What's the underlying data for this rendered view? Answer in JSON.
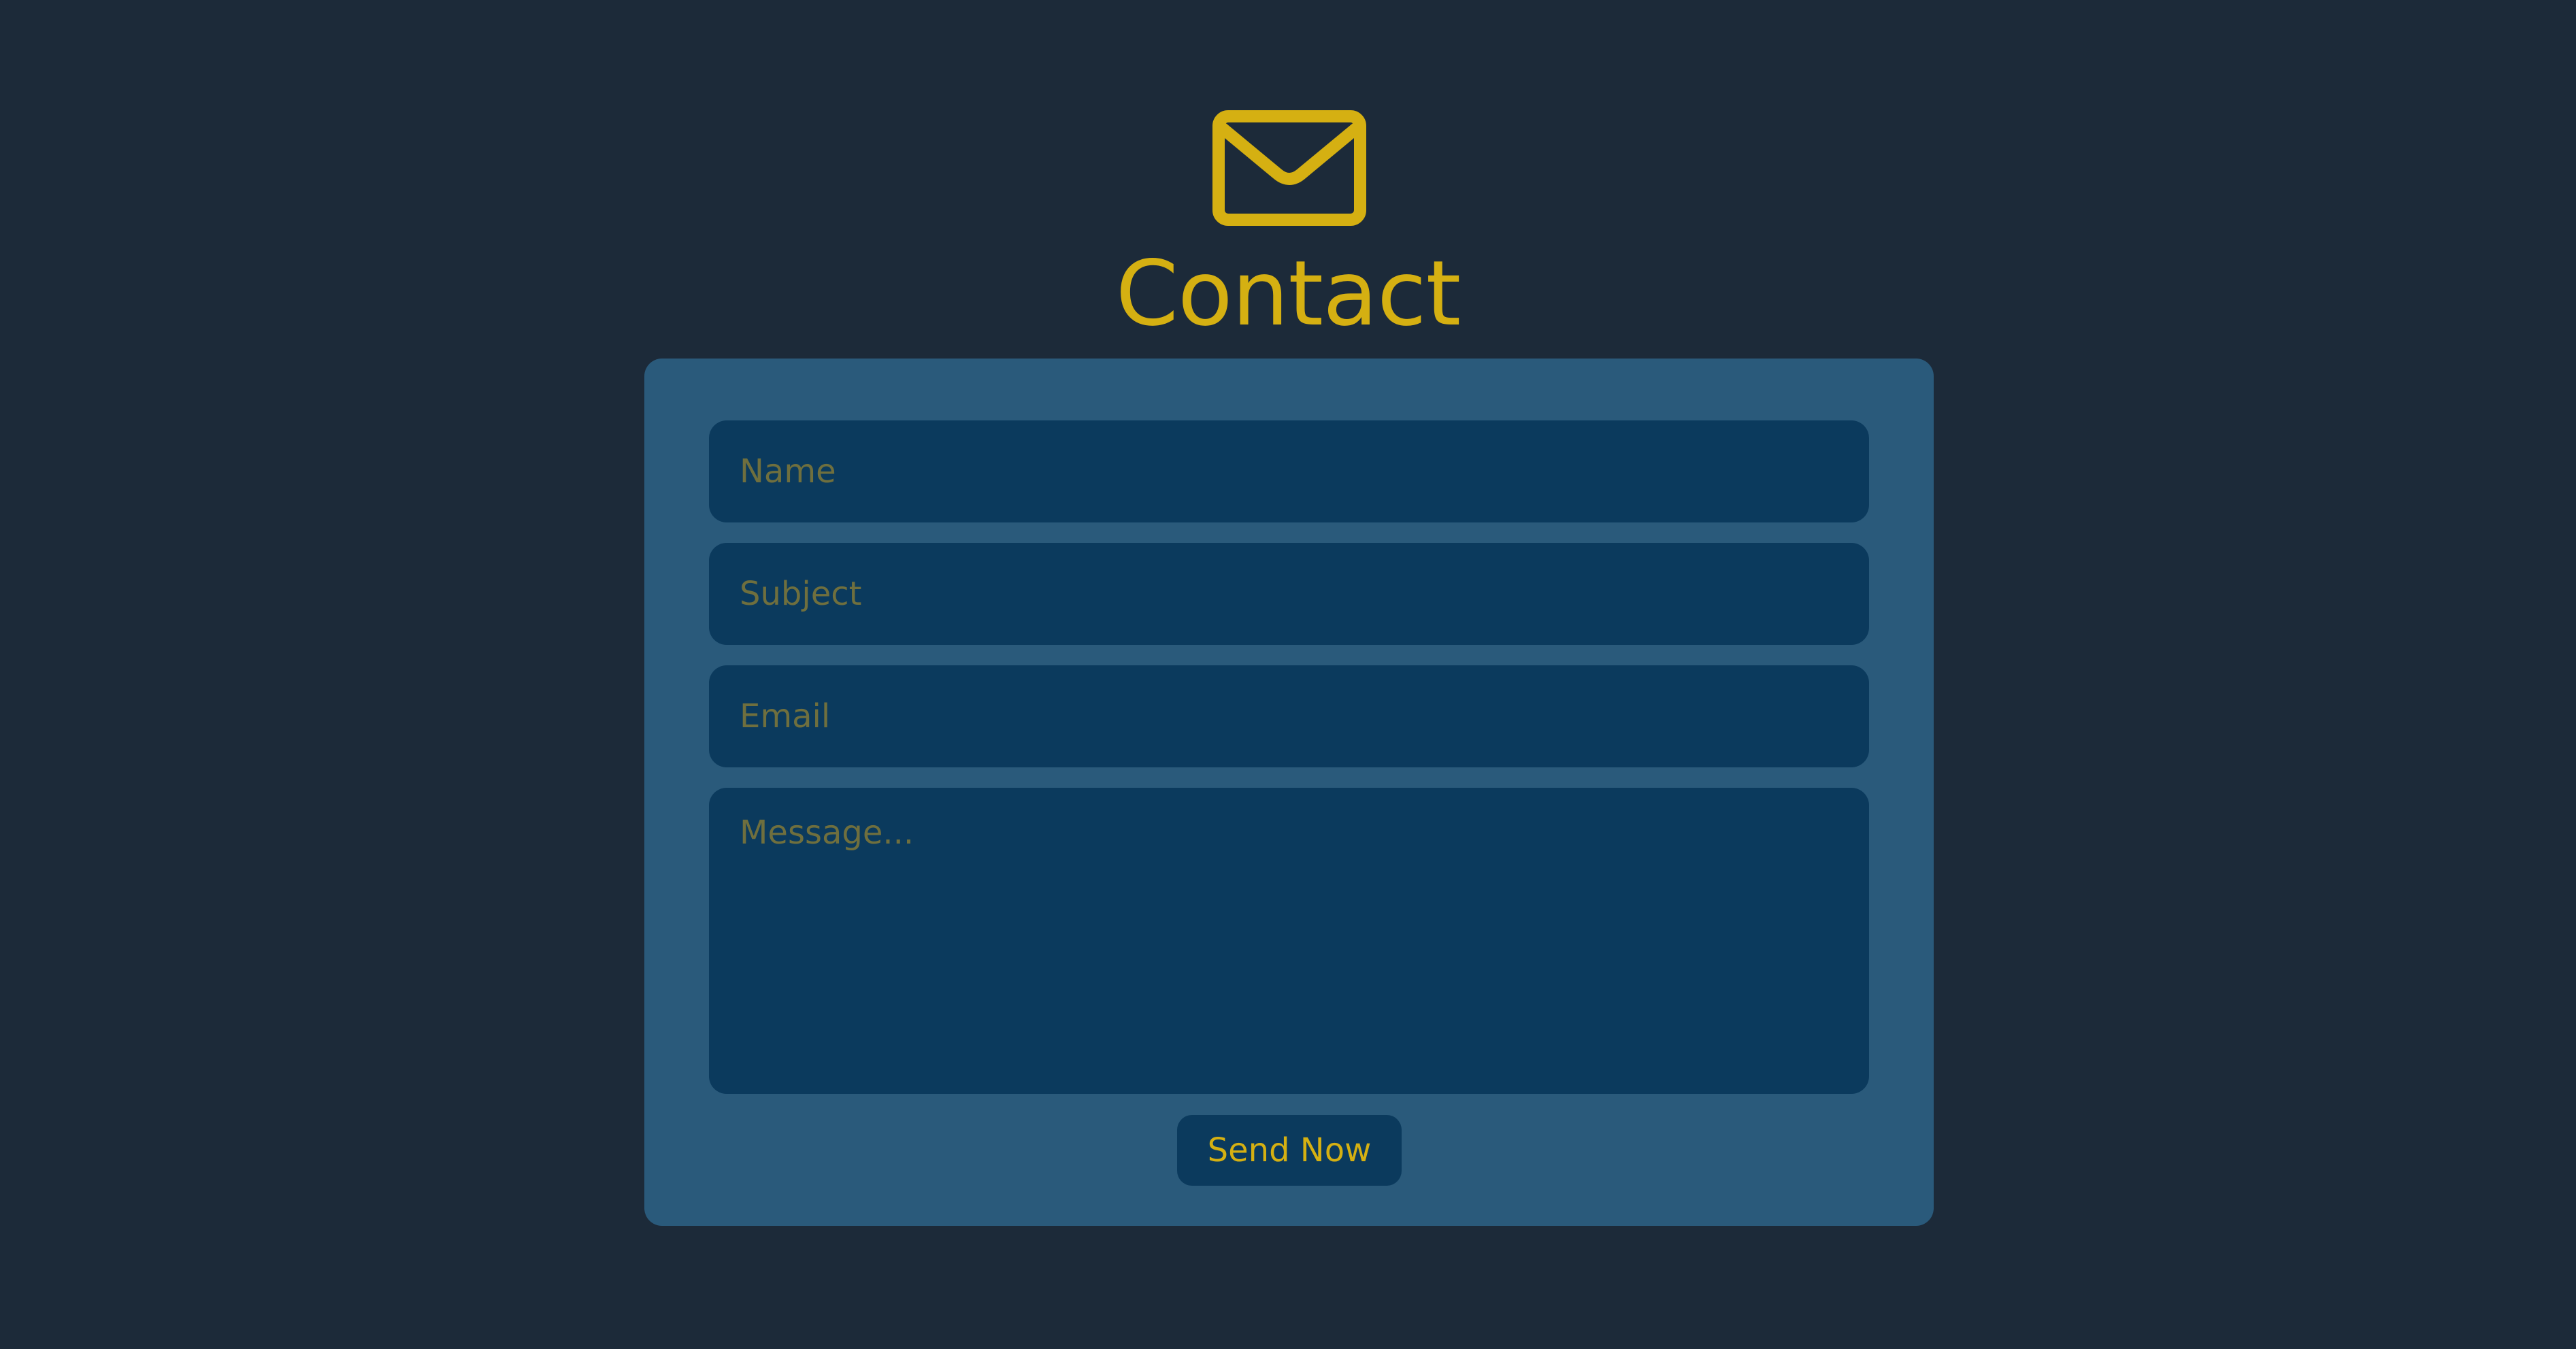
{
  "header": {
    "icon": "mail-icon",
    "title": "Contact"
  },
  "form": {
    "name_placeholder": "Name",
    "subject_placeholder": "Subject",
    "email_placeholder": "Email",
    "message_placeholder": "Message...",
    "submit_label": "Send Now"
  },
  "colors": {
    "background": "#1c2a39",
    "card": "#2a5a7b",
    "field": "#0b3a5d",
    "accent": "#d5b012",
    "placeholder": "#6f6f3e"
  }
}
